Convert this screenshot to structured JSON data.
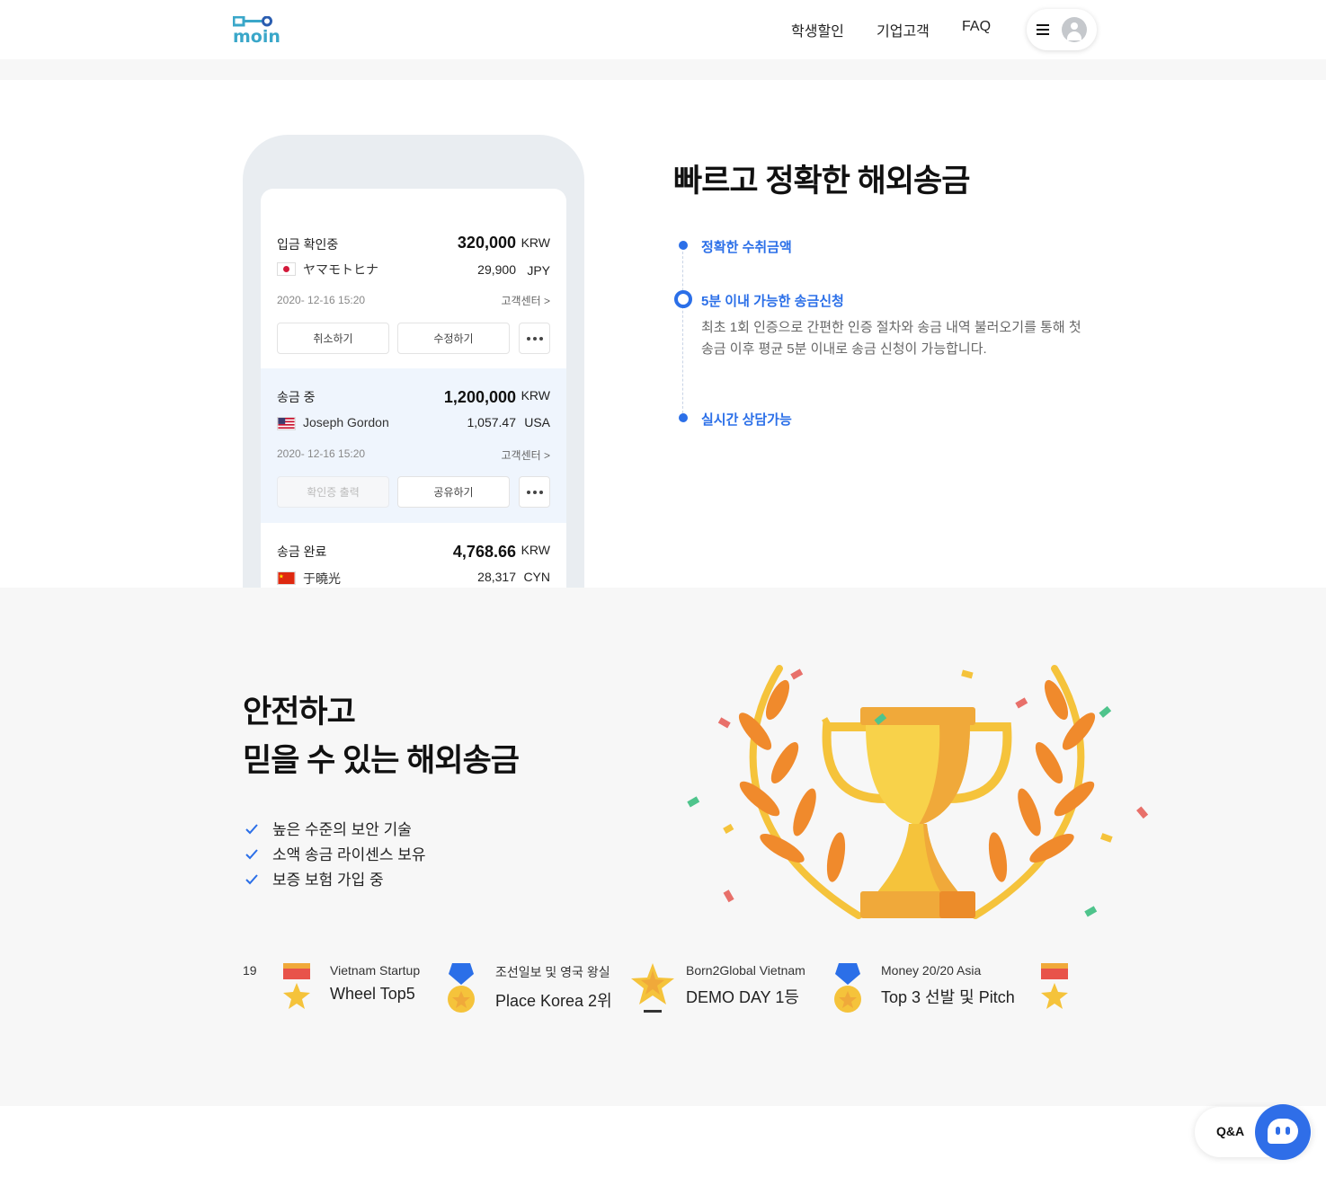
{
  "header": {
    "logo_text": "moin",
    "nav": [
      "학생할인",
      "기업고객",
      "FAQ"
    ]
  },
  "phone": {
    "cards": [
      {
        "status": "입금 확인중",
        "amount": "320,000",
        "amount_currency": "KRW",
        "name": "ヤマモトヒナ",
        "sub_amount": "29,900",
        "sub_currency": "JPY",
        "date": "2020- 12-16  15:20",
        "help": "고객센터 >",
        "buttons": [
          "취소하기",
          "수정하기"
        ]
      },
      {
        "status": "송금 중",
        "amount": "1,200,000",
        "amount_currency": "KRW",
        "name": "Joseph Gordon",
        "sub_amount": "1,057.47",
        "sub_currency": "USA",
        "date": "2020- 12-16  15:20",
        "help": "고객센터 >",
        "buttons": [
          "확인증 출력",
          "공유하기"
        ]
      },
      {
        "status": "송금 완료",
        "amount": "4,768.66",
        "amount_currency": "KRW",
        "name": "于曉光",
        "sub_amount": "28,317",
        "sub_currency": "CYN"
      }
    ]
  },
  "feature1": {
    "title": "빠르고 정확한 해외송금",
    "items": [
      {
        "label": "정확한 수취금액"
      },
      {
        "label": "5분 이내 가능한 송금신청",
        "desc": "최초 1회 인증으로 간편한 인증 절차와 송금 내역 불러오기를 통해 첫 송금 이후 평균 5분 이내로 송금 신청이 가능합니다."
      },
      {
        "label": "실시간 상담가능"
      }
    ]
  },
  "feature2": {
    "title_line1": "안전하고",
    "title_line2": "믿을 수 있는 해외송금",
    "checks": [
      "높은 수준의 보안 기술",
      "소액 송금 라이센스 보유",
      "보증 보험 가입 중"
    ]
  },
  "awards": {
    "partial": "19",
    "items": [
      {
        "line1": "Vietnam Startup",
        "line2": "Wheel Top5"
      },
      {
        "line1": "조선일보 및 영국 왕실",
        "line2": "Place Korea 2위"
      },
      {
        "line1": "Born2Global Vietnam",
        "line2": "DEMO DAY 1등"
      },
      {
        "line1": "Money 20/20 Asia",
        "line2": "Top 3 선발 및 Pitch"
      }
    ]
  },
  "qa": {
    "label": "Q&A"
  },
  "colors": {
    "accent": "#2b6fe8",
    "trophy": "#f5c33b",
    "laurel": "#f08a2c"
  }
}
